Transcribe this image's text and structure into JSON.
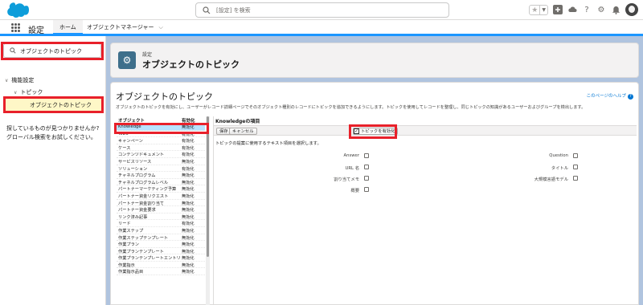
{
  "header": {
    "search_placeholder": "[設定] を検索",
    "icons": [
      "salesforce-logo",
      "star-icon",
      "plus-icon",
      "cloud-icon",
      "help-icon",
      "gear-icon",
      "bell-icon",
      "avatar"
    ]
  },
  "context": {
    "app_name": "設定",
    "tabs": [
      {
        "label": "ホーム",
        "active": true
      },
      {
        "label": "オブジェクトマネージャー",
        "active": false
      }
    ]
  },
  "nav": {
    "quickfind_value": "オブジェクトのトピック",
    "items": [
      {
        "label": "機能設定",
        "level": 0
      },
      {
        "label": "トピック",
        "level": 1
      },
      {
        "label": "オブジェクトのトピック",
        "level": 2,
        "selected": true
      }
    ],
    "not_found_line1": "探しているものが見つかりませんか?",
    "not_found_line2": "グローバル検索をお試しください。"
  },
  "page_header": {
    "kicker": "設定",
    "title": "オブジェクトのトピック"
  },
  "main": {
    "title": "オブジェクトのトピック",
    "help_link": "このページのヘルプ",
    "description": "オブジェクトのトピックを有効にし、ユーザーがレコード詳細ページでそのオブジェクト種別のレコードにトピックを追加できるようにします。トピックを使用してレコードを整理し、同じトピックの知識があるユーザーおよびグループを検出します。",
    "list_header_object": "オブジェクト",
    "list_header_status": "有効化",
    "objects": [
      {
        "name": "Knowledge",
        "status": "無効化",
        "selected": true
      },
      {
        "name": "ToDo",
        "status": "有効化"
      },
      {
        "name": "キャンペーン",
        "status": "有効化"
      },
      {
        "name": "ケース",
        "status": "有効化"
      },
      {
        "name": "コンテンツドキュメント",
        "status": "有効化"
      },
      {
        "name": "サービスリソース",
        "status": "無効化"
      },
      {
        "name": "ソリューション",
        "status": "有効化"
      },
      {
        "name": "チャネルプログラム",
        "status": "無効化"
      },
      {
        "name": "チャネルプログラムレベル",
        "status": "無効化"
      },
      {
        "name": "パートナーマーケティング予算",
        "status": "無効化"
      },
      {
        "name": "パートナー資金リクエスト",
        "status": "無効化"
      },
      {
        "name": "パートナー資金割り当て",
        "status": "無効化"
      },
      {
        "name": "パートナー資金要求",
        "status": "無効化"
      },
      {
        "name": "リンク済み記事",
        "status": "無効化"
      },
      {
        "name": "リード",
        "status": "有効化"
      },
      {
        "name": "作業ステップ",
        "status": "無効化"
      },
      {
        "name": "作業ステップテンプレート",
        "status": "無効化"
      },
      {
        "name": "作業プラン",
        "status": "無効化"
      },
      {
        "name": "作業プランテンプレート",
        "status": "無効化"
      },
      {
        "name": "作業プランテンプレートエントリ",
        "status": "無効化"
      },
      {
        "name": "作業指示",
        "status": "無効化"
      },
      {
        "name": "作業指示品目",
        "status": "無効化"
      }
    ],
    "fields_title": "Knowledgeの項目",
    "save_label": "保存",
    "cancel_label": "キャンセル",
    "enable_label": "トピックを有効化",
    "enable_checked": true,
    "instruction": "トピックの提案に使用するテキスト項目を選択します。",
    "fields_left": [
      "Answer",
      "URL 名",
      "割り当てメモ",
      "概要"
    ],
    "fields_right": [
      "Question",
      "タイトル",
      "大規模言語モデル"
    ]
  }
}
